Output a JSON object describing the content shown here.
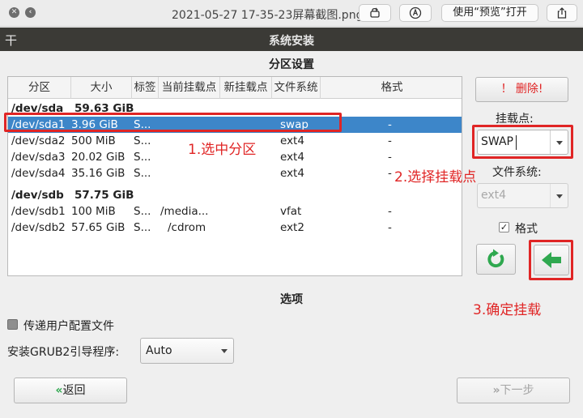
{
  "preview_window": {
    "filename": "2021-05-27 17-35-23屏幕截图.png",
    "open_with_label": "使用“预览”打开",
    "close_glyph": "✕",
    "back_glyph": "‹",
    "icons": [
      "close-icon",
      "back-icon",
      "rotate-icon",
      "markup-icon",
      "share-icon"
    ]
  },
  "app": {
    "title": "系统安装",
    "menu_glyph": "干"
  },
  "partition_section": {
    "title": "分区设置",
    "columns": [
      "分区",
      "大小",
      "标签",
      "当前挂载点",
      "新挂载点",
      "文件系统",
      "格式"
    ],
    "rows": [
      {
        "kind": "disk",
        "device": "/dev/sda",
        "size": "59.63 GiB",
        "label": "",
        "current": "",
        "new": "",
        "fs": "",
        "format": ""
      },
      {
        "kind": "part",
        "device": "/dev/sda1",
        "size": "3.96 GiB",
        "label": "S...",
        "current": "",
        "new": "",
        "fs": "swap",
        "format": "-",
        "selected": true
      },
      {
        "kind": "part",
        "device": "/dev/sda2",
        "size": "500 MiB",
        "label": "S...",
        "current": "",
        "new": "",
        "fs": "ext4",
        "format": "-"
      },
      {
        "kind": "part",
        "device": "/dev/sda3",
        "size": "20.02 GiB",
        "label": "S...",
        "current": "",
        "new": "",
        "fs": "ext4",
        "format": "-"
      },
      {
        "kind": "part",
        "device": "/dev/sda4",
        "size": "35.16 GiB",
        "label": "S...",
        "current": "",
        "new": "",
        "fs": "ext4",
        "format": "-"
      },
      {
        "kind": "disk",
        "device": "/dev/sdb",
        "size": "57.75 GiB",
        "label": "",
        "current": "",
        "new": "",
        "fs": "",
        "format": ""
      },
      {
        "kind": "part",
        "device": "/dev/sdb1",
        "size": "100 MiB",
        "label": "S...",
        "current": "/media...",
        "new": "",
        "fs": "vfat",
        "format": "-"
      },
      {
        "kind": "part",
        "device": "/dev/sdb2",
        "size": "57.65 GiB",
        "label": "S...",
        "current": "/cdrom",
        "new": "",
        "fs": "ext2",
        "format": "-"
      }
    ]
  },
  "right_panel": {
    "delete_label": "！ 删除!",
    "mount_label": "挂载点:",
    "mount_value": "SWAP",
    "fs_label": "文件系统:",
    "fs_value": "ext4",
    "format_label": "格式",
    "format_checked": "✓",
    "refresh_icon": "↻",
    "apply_icon": "⬅"
  },
  "annotations": {
    "step1": "1.选中分区",
    "step2": "2.选择挂载点",
    "step3": "3.确定挂载"
  },
  "options_section": {
    "title": "选项",
    "pass_user_config_label": "传递用户配置文件",
    "grub_label": "安装GRUB2引导程序:",
    "grub_value": "Auto"
  },
  "footer": {
    "back_label": "返回",
    "back_glyph": "«",
    "next_label": "下一步",
    "next_glyph": "»"
  },
  "colors": {
    "selection": "#3d86c9",
    "annotation": "#e02525",
    "delete_text": "#e02525",
    "apply_green": "#2fa84f",
    "app_titlebar": "#3b3a36"
  }
}
